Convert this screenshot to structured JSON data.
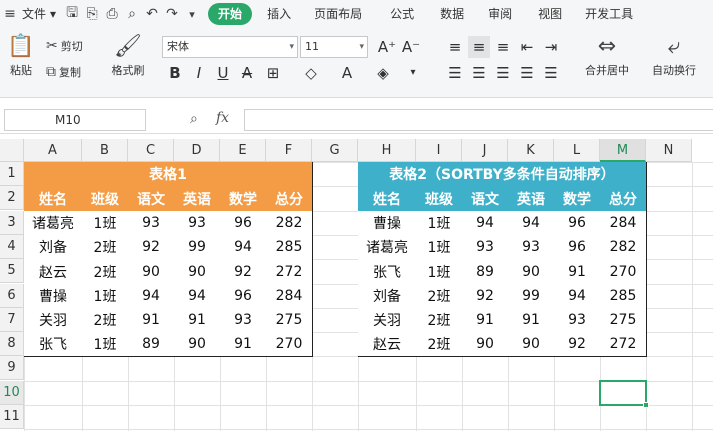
{
  "menu": {
    "file": "文件",
    "file_arrow": "▾",
    "more": "▾",
    "tabs": [
      "开始",
      "插入",
      "页面布局",
      "公式",
      "数据",
      "审阅",
      "视图",
      "开发工具"
    ]
  },
  "ribbon": {
    "paste": "粘贴",
    "cut": "剪切",
    "copy": "复制",
    "format_painter": "格式刷",
    "font_name": "宋体",
    "font_size": "11",
    "merge_center": "合并居中",
    "wrap_text": "自动换行"
  },
  "formula_bar": {
    "name_box": "M10",
    "fx": "fx",
    "value": ""
  },
  "grid": {
    "columns": [
      "A",
      "B",
      "C",
      "D",
      "E",
      "F",
      "G",
      "H",
      "I",
      "J",
      "K",
      "L",
      "M",
      "N"
    ],
    "rows": [
      "1",
      "2",
      "3",
      "4",
      "5",
      "6",
      "7",
      "8",
      "9",
      "10",
      "11"
    ],
    "selected_cell": "M10"
  },
  "table1": {
    "title": "表格1",
    "headers": [
      "姓名",
      "班级",
      "语文",
      "英语",
      "数学",
      "总分"
    ],
    "rows": [
      [
        "诸葛亮",
        "1班",
        "93",
        "93",
        "96",
        "282"
      ],
      [
        "刘备",
        "2班",
        "92",
        "99",
        "94",
        "285"
      ],
      [
        "赵云",
        "2班",
        "90",
        "90",
        "92",
        "272"
      ],
      [
        "曹操",
        "1班",
        "94",
        "94",
        "96",
        "284"
      ],
      [
        "关羽",
        "2班",
        "91",
        "91",
        "93",
        "275"
      ],
      [
        "张飞",
        "1班",
        "89",
        "90",
        "91",
        "270"
      ]
    ]
  },
  "table2": {
    "title": "表格2（SORTBY多条件自动排序）",
    "headers": [
      "姓名",
      "班级",
      "语文",
      "英语",
      "数学",
      "总分"
    ],
    "rows": [
      [
        "曹操",
        "1班",
        "94",
        "94",
        "96",
        "284"
      ],
      [
        "诸葛亮",
        "1班",
        "93",
        "93",
        "96",
        "282"
      ],
      [
        "张飞",
        "1班",
        "89",
        "90",
        "91",
        "270"
      ],
      [
        "刘备",
        "2班",
        "92",
        "99",
        "94",
        "285"
      ],
      [
        "关羽",
        "2班",
        "91",
        "91",
        "93",
        "275"
      ],
      [
        "赵云",
        "2班",
        "90",
        "90",
        "92",
        "272"
      ]
    ]
  },
  "colors": {
    "accent": "#2aa86a",
    "table1_header": "#f39c45",
    "table2_header": "#3fb0c9"
  }
}
